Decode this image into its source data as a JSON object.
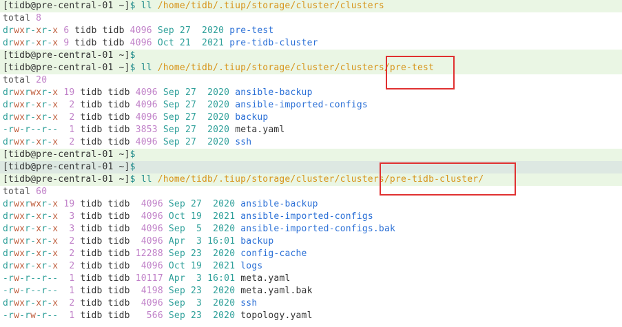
{
  "prompt": "[tidb@pre-central-01 ~]",
  "dollar": "$",
  "cmd": "ll",
  "commands": {
    "c1": "/home/tidb/.tiup/storage/cluster/clusters",
    "c2": "/home/tidb/.tiup/storage/cluster/clusters/pre-test",
    "c3": "/home/tidb/.tiup/storage/cluster/clusters/pre-tidb-cluster/"
  },
  "totals": {
    "t1": "8",
    "t2": "20",
    "t3": "60"
  },
  "total_label": "total",
  "listing1": [
    {
      "perm": "drwxr-xr-x",
      "links": "6",
      "owner": "tidb",
      "group": "tidb",
      "size": "4096",
      "month": "Sep",
      "day": "27",
      "time": "2020",
      "name": "pre-test"
    },
    {
      "perm": "drwxr-xr-x",
      "links": "9",
      "owner": "tidb",
      "group": "tidb",
      "size": "4096",
      "month": "Oct",
      "day": "21",
      "time": "2021",
      "name": "pre-tidb-cluster"
    }
  ],
  "listing2": [
    {
      "perm": "drwxrwxr-x",
      "links": "19",
      "owner": "tidb",
      "group": "tidb",
      "size": "4096",
      "month": "Sep",
      "day": "27",
      "time": "2020",
      "name": "ansible-backup"
    },
    {
      "perm": "drwxr-xr-x",
      "links": "2",
      "owner": "tidb",
      "group": "tidb",
      "size": "4096",
      "month": "Sep",
      "day": "27",
      "time": "2020",
      "name": "ansible-imported-configs"
    },
    {
      "perm": "drwxr-xr-x",
      "links": "2",
      "owner": "tidb",
      "group": "tidb",
      "size": "4096",
      "month": "Sep",
      "day": "27",
      "time": "2020",
      "name": "backup"
    },
    {
      "perm": "-rw-r--r--",
      "links": "1",
      "owner": "tidb",
      "group": "tidb",
      "size": "3853",
      "month": "Sep",
      "day": "27",
      "time": "2020",
      "name": "meta.yaml"
    },
    {
      "perm": "drwxr-xr-x",
      "links": "2",
      "owner": "tidb",
      "group": "tidb",
      "size": "4096",
      "month": "Sep",
      "day": "27",
      "time": "2020",
      "name": "ssh"
    }
  ],
  "listing3": [
    {
      "perm": "drwxrwxr-x",
      "links": "19",
      "owner": "tidb",
      "group": "tidb",
      "size": "4096",
      "month": "Sep",
      "day": "27",
      "time": "2020",
      "name": "ansible-backup"
    },
    {
      "perm": "drwxr-xr-x",
      "links": "3",
      "owner": "tidb",
      "group": "tidb",
      "size": "4096",
      "month": "Oct",
      "day": "19",
      "time": "2021",
      "name": "ansible-imported-configs"
    },
    {
      "perm": "drwxr-xr-x",
      "links": "3",
      "owner": "tidb",
      "group": "tidb",
      "size": "4096",
      "month": "Sep",
      "day": "5",
      "time": "2020",
      "name": "ansible-imported-configs.bak"
    },
    {
      "perm": "drwxr-xr-x",
      "links": "2",
      "owner": "tidb",
      "group": "tidb",
      "size": "4096",
      "month": "Apr",
      "day": "3",
      "time": "16:01",
      "name": "backup"
    },
    {
      "perm": "drwxr-xr-x",
      "links": "2",
      "owner": "tidb",
      "group": "tidb",
      "size": "12288",
      "month": "Sep",
      "day": "23",
      "time": "2020",
      "name": "config-cache"
    },
    {
      "perm": "drwxr-xr-x",
      "links": "2",
      "owner": "tidb",
      "group": "tidb",
      "size": "4096",
      "month": "Oct",
      "day": "19",
      "time": "2021",
      "name": "logs"
    },
    {
      "perm": "-rw-r--r--",
      "links": "1",
      "owner": "tidb",
      "group": "tidb",
      "size": "10117",
      "month": "Apr",
      "day": "3",
      "time": "16:01",
      "name": "meta.yaml"
    },
    {
      "perm": "-rw-r--r--",
      "links": "1",
      "owner": "tidb",
      "group": "tidb",
      "size": "4198",
      "month": "Sep",
      "day": "23",
      "time": "2020",
      "name": "meta.yaml.bak"
    },
    {
      "perm": "drwxr-xr-x",
      "links": "2",
      "owner": "tidb",
      "group": "tidb",
      "size": "4096",
      "month": "Sep",
      "day": "3",
      "time": "2020",
      "name": "ssh"
    },
    {
      "perm": "-rw-rw-r--",
      "links": "1",
      "owner": "tidb",
      "group": "tidb",
      "size": "566",
      "month": "Sep",
      "day": "23",
      "time": "2020",
      "name": "topology.yaml"
    }
  ]
}
